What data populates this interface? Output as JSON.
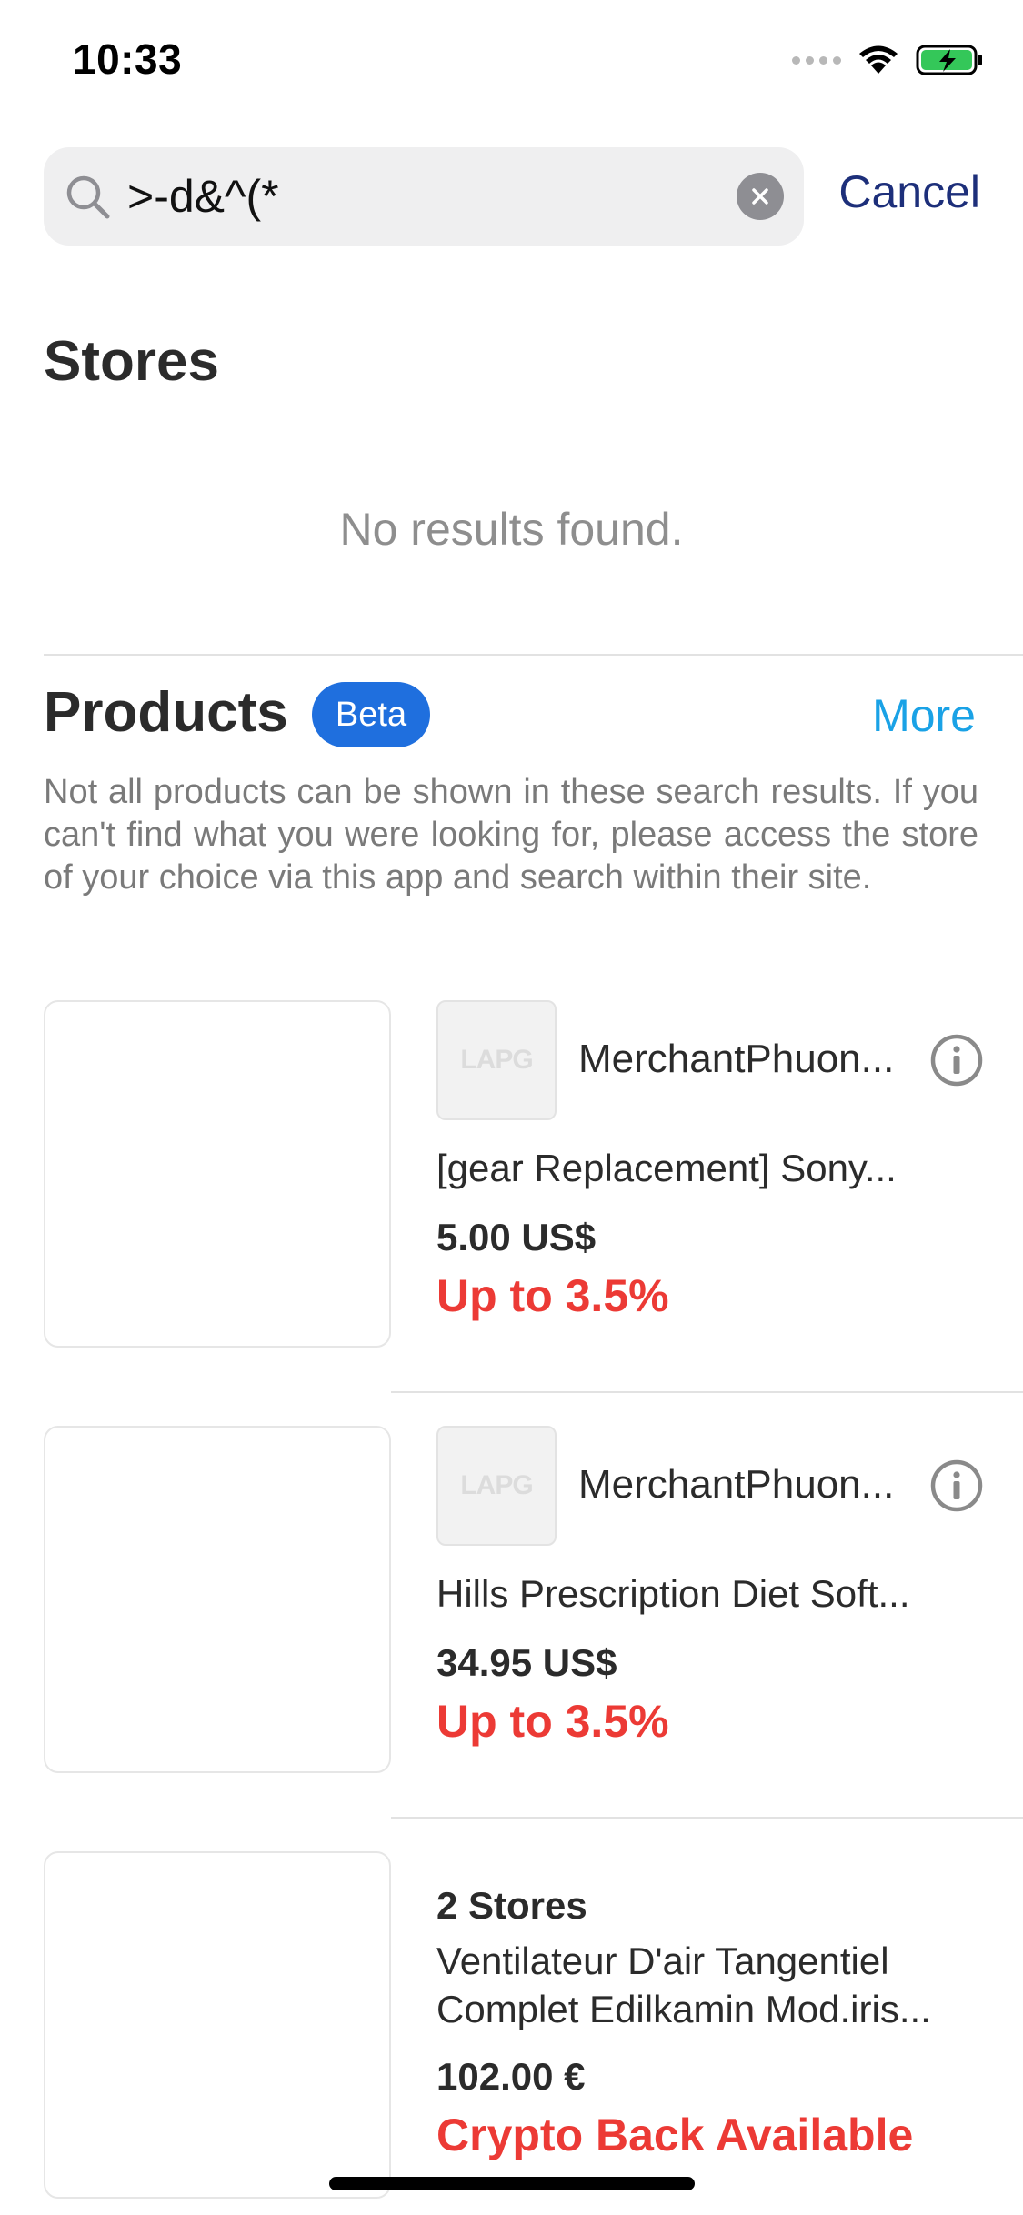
{
  "status_bar": {
    "time": "10:33",
    "icons": [
      "cellular-dots-icon",
      "wifi-icon",
      "battery-charging-icon"
    ],
    "battery_color": "#34c759"
  },
  "search": {
    "query": ">-d&^(*",
    "cancel_label": "Cancel",
    "icon": "search-icon",
    "clear_icon": "clear-icon"
  },
  "stores": {
    "title": "Stores",
    "empty_text": "No results found."
  },
  "products": {
    "title": "Products",
    "badge": "Beta",
    "more_label": "More",
    "disclaimer": "Not all products can be shown in these search results. If you can't find what you were looking for, please access the store of your choice via this app and search within their site.",
    "items": [
      {
        "merchant_name": "MerchantPhuon...",
        "merchant_logo_text": "LAPG",
        "title": "[gear Replacement] Sony...",
        "price": "5.00 US$",
        "cashback": "Up to 3.5%"
      },
      {
        "merchant_name": "MerchantPhuon...",
        "merchant_logo_text": "LAPG",
        "title": "Hills Prescription Diet Soft...",
        "price": "34.95 US$",
        "cashback": "Up to 3.5%"
      },
      {
        "store_count": "2 Stores",
        "title": "Ventilateur D'air Tangentiel Complet Edilkamin Mod.iris...",
        "price": "102.00 €",
        "cashback": "Crypto Back Available"
      }
    ]
  },
  "colors": {
    "brand_blue": "#1f6fde",
    "link_cyan": "#1aa2e6",
    "cancel_navy": "#1d2f7a",
    "cashback_red": "#ec3a35"
  }
}
